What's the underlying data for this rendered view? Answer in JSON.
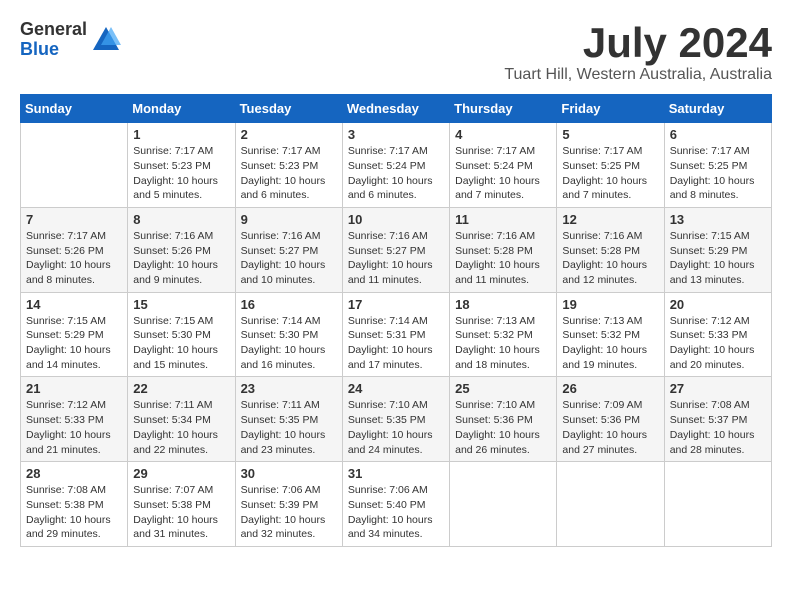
{
  "logo": {
    "general": "General",
    "blue": "Blue"
  },
  "title": {
    "month_year": "July 2024",
    "location": "Tuart Hill, Western Australia, Australia"
  },
  "weekdays": [
    "Sunday",
    "Monday",
    "Tuesday",
    "Wednesday",
    "Thursday",
    "Friday",
    "Saturday"
  ],
  "weeks": [
    [
      {
        "day": "",
        "info": ""
      },
      {
        "day": "1",
        "info": "Sunrise: 7:17 AM\nSunset: 5:23 PM\nDaylight: 10 hours\nand 5 minutes."
      },
      {
        "day": "2",
        "info": "Sunrise: 7:17 AM\nSunset: 5:23 PM\nDaylight: 10 hours\nand 6 minutes."
      },
      {
        "day": "3",
        "info": "Sunrise: 7:17 AM\nSunset: 5:24 PM\nDaylight: 10 hours\nand 6 minutes."
      },
      {
        "day": "4",
        "info": "Sunrise: 7:17 AM\nSunset: 5:24 PM\nDaylight: 10 hours\nand 7 minutes."
      },
      {
        "day": "5",
        "info": "Sunrise: 7:17 AM\nSunset: 5:25 PM\nDaylight: 10 hours\nand 7 minutes."
      },
      {
        "day": "6",
        "info": "Sunrise: 7:17 AM\nSunset: 5:25 PM\nDaylight: 10 hours\nand 8 minutes."
      }
    ],
    [
      {
        "day": "7",
        "info": "Sunrise: 7:17 AM\nSunset: 5:26 PM\nDaylight: 10 hours\nand 8 minutes."
      },
      {
        "day": "8",
        "info": "Sunrise: 7:16 AM\nSunset: 5:26 PM\nDaylight: 10 hours\nand 9 minutes."
      },
      {
        "day": "9",
        "info": "Sunrise: 7:16 AM\nSunset: 5:27 PM\nDaylight: 10 hours\nand 10 minutes."
      },
      {
        "day": "10",
        "info": "Sunrise: 7:16 AM\nSunset: 5:27 PM\nDaylight: 10 hours\nand 11 minutes."
      },
      {
        "day": "11",
        "info": "Sunrise: 7:16 AM\nSunset: 5:28 PM\nDaylight: 10 hours\nand 11 minutes."
      },
      {
        "day": "12",
        "info": "Sunrise: 7:16 AM\nSunset: 5:28 PM\nDaylight: 10 hours\nand 12 minutes."
      },
      {
        "day": "13",
        "info": "Sunrise: 7:15 AM\nSunset: 5:29 PM\nDaylight: 10 hours\nand 13 minutes."
      }
    ],
    [
      {
        "day": "14",
        "info": "Sunrise: 7:15 AM\nSunset: 5:29 PM\nDaylight: 10 hours\nand 14 minutes."
      },
      {
        "day": "15",
        "info": "Sunrise: 7:15 AM\nSunset: 5:30 PM\nDaylight: 10 hours\nand 15 minutes."
      },
      {
        "day": "16",
        "info": "Sunrise: 7:14 AM\nSunset: 5:30 PM\nDaylight: 10 hours\nand 16 minutes."
      },
      {
        "day": "17",
        "info": "Sunrise: 7:14 AM\nSunset: 5:31 PM\nDaylight: 10 hours\nand 17 minutes."
      },
      {
        "day": "18",
        "info": "Sunrise: 7:13 AM\nSunset: 5:32 PM\nDaylight: 10 hours\nand 18 minutes."
      },
      {
        "day": "19",
        "info": "Sunrise: 7:13 AM\nSunset: 5:32 PM\nDaylight: 10 hours\nand 19 minutes."
      },
      {
        "day": "20",
        "info": "Sunrise: 7:12 AM\nSunset: 5:33 PM\nDaylight: 10 hours\nand 20 minutes."
      }
    ],
    [
      {
        "day": "21",
        "info": "Sunrise: 7:12 AM\nSunset: 5:33 PM\nDaylight: 10 hours\nand 21 minutes."
      },
      {
        "day": "22",
        "info": "Sunrise: 7:11 AM\nSunset: 5:34 PM\nDaylight: 10 hours\nand 22 minutes."
      },
      {
        "day": "23",
        "info": "Sunrise: 7:11 AM\nSunset: 5:35 PM\nDaylight: 10 hours\nand 23 minutes."
      },
      {
        "day": "24",
        "info": "Sunrise: 7:10 AM\nSunset: 5:35 PM\nDaylight: 10 hours\nand 24 minutes."
      },
      {
        "day": "25",
        "info": "Sunrise: 7:10 AM\nSunset: 5:36 PM\nDaylight: 10 hours\nand 26 minutes."
      },
      {
        "day": "26",
        "info": "Sunrise: 7:09 AM\nSunset: 5:36 PM\nDaylight: 10 hours\nand 27 minutes."
      },
      {
        "day": "27",
        "info": "Sunrise: 7:08 AM\nSunset: 5:37 PM\nDaylight: 10 hours\nand 28 minutes."
      }
    ],
    [
      {
        "day": "28",
        "info": "Sunrise: 7:08 AM\nSunset: 5:38 PM\nDaylight: 10 hours\nand 29 minutes."
      },
      {
        "day": "29",
        "info": "Sunrise: 7:07 AM\nSunset: 5:38 PM\nDaylight: 10 hours\nand 31 minutes."
      },
      {
        "day": "30",
        "info": "Sunrise: 7:06 AM\nSunset: 5:39 PM\nDaylight: 10 hours\nand 32 minutes."
      },
      {
        "day": "31",
        "info": "Sunrise: 7:06 AM\nSunset: 5:40 PM\nDaylight: 10 hours\nand 34 minutes."
      },
      {
        "day": "",
        "info": ""
      },
      {
        "day": "",
        "info": ""
      },
      {
        "day": "",
        "info": ""
      }
    ]
  ]
}
